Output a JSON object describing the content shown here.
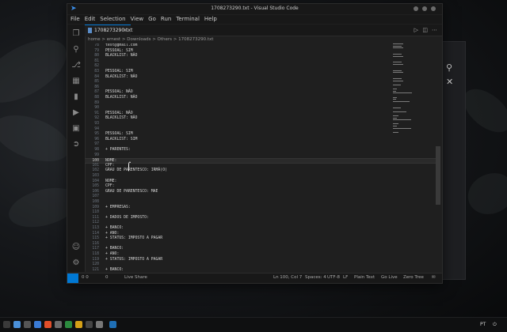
{
  "window": {
    "title": "1708273290.txt - Visual Studio Code",
    "menu": [
      "File",
      "Edit",
      "Selection",
      "View",
      "Go",
      "Run",
      "Terminal",
      "Help"
    ]
  },
  "tab": {
    "label": "1708273290.txt"
  },
  "breadcrumb": "home  >  ernest  >  Downloads  >  Others  >  1708273290.txt",
  "editor": {
    "current_line": "100",
    "lines": [
      {
        "n": "78",
        "t": "test@gmail.com"
      },
      {
        "n": "79",
        "t": "PESSOAL: SIM"
      },
      {
        "n": "80",
        "t": "BLACKLIST: NÃO"
      },
      {
        "n": "81",
        "t": ""
      },
      {
        "n": "82",
        "t": ""
      },
      {
        "n": "83",
        "t": "PESSOAL: SIM"
      },
      {
        "n": "84",
        "t": "BLACKLIST: NÃO"
      },
      {
        "n": "85",
        "t": ""
      },
      {
        "n": "86",
        "t": ""
      },
      {
        "n": "87",
        "t": "PESSOAL: NÃO"
      },
      {
        "n": "88",
        "t": "BLACKLIST: NÃO"
      },
      {
        "n": "89",
        "t": ""
      },
      {
        "n": "90",
        "t": ""
      },
      {
        "n": "91",
        "t": "PESSOAL: NÃO"
      },
      {
        "n": "92",
        "t": "BLACKLIST: NÃO"
      },
      {
        "n": "93",
        "t": ""
      },
      {
        "n": "94",
        "t": ""
      },
      {
        "n": "95",
        "t": "PESSOAL: SIM"
      },
      {
        "n": "96",
        "t": "BLACKLIST: SIM"
      },
      {
        "n": "97",
        "t": ""
      },
      {
        "n": "98",
        "t": "+ PARENTES:"
      },
      {
        "n": "99",
        "t": ""
      },
      {
        "n": "100",
        "t": "NOME: "
      },
      {
        "n": "101",
        "t": "CPF:"
      },
      {
        "n": "102",
        "t": "GRAU DE PARENTESCO: IRMÃ(O)"
      },
      {
        "n": "103",
        "t": ""
      },
      {
        "n": "104",
        "t": "NOME:"
      },
      {
        "n": "105",
        "t": "CPF:"
      },
      {
        "n": "106",
        "t": "GRAU DE PARENTESCO: MAE"
      },
      {
        "n": "107",
        "t": ""
      },
      {
        "n": "108",
        "t": ""
      },
      {
        "n": "109",
        "t": "+ EMPRESAS:"
      },
      {
        "n": "110",
        "t": ""
      },
      {
        "n": "111",
        "t": "+ DADOS DE IMPOSTO:"
      },
      {
        "n": "112",
        "t": ""
      },
      {
        "n": "113",
        "t": "+ BANCO:"
      },
      {
        "n": "114",
        "t": "+ ANO:"
      },
      {
        "n": "115",
        "t": "+ STATUS: IMPOSTO A PAGAR"
      },
      {
        "n": "116",
        "t": ""
      },
      {
        "n": "117",
        "t": "+ BANCO:"
      },
      {
        "n": "118",
        "t": "+ ANO:"
      },
      {
        "n": "119",
        "t": "+ STATUS: IMPOSTO A PAGAR"
      },
      {
        "n": "120",
        "t": ""
      },
      {
        "n": "121",
        "t": "+ BANCO:"
      }
    ]
  },
  "status": {
    "problems": "0  0",
    "warnings": "0",
    "live_share": "Live Share",
    "position": "Ln 100, Col 7",
    "spaces": "Spaces: 4",
    "encoding": "UTF-8",
    "eol": "LF",
    "language": "Plain Text",
    "go_live": "Go Live",
    "zero_tree": "Zero Tree"
  },
  "taskbar": {
    "lang": "PT"
  },
  "colors": {
    "accent": "#0078d4",
    "background": "#1f1f1f"
  }
}
